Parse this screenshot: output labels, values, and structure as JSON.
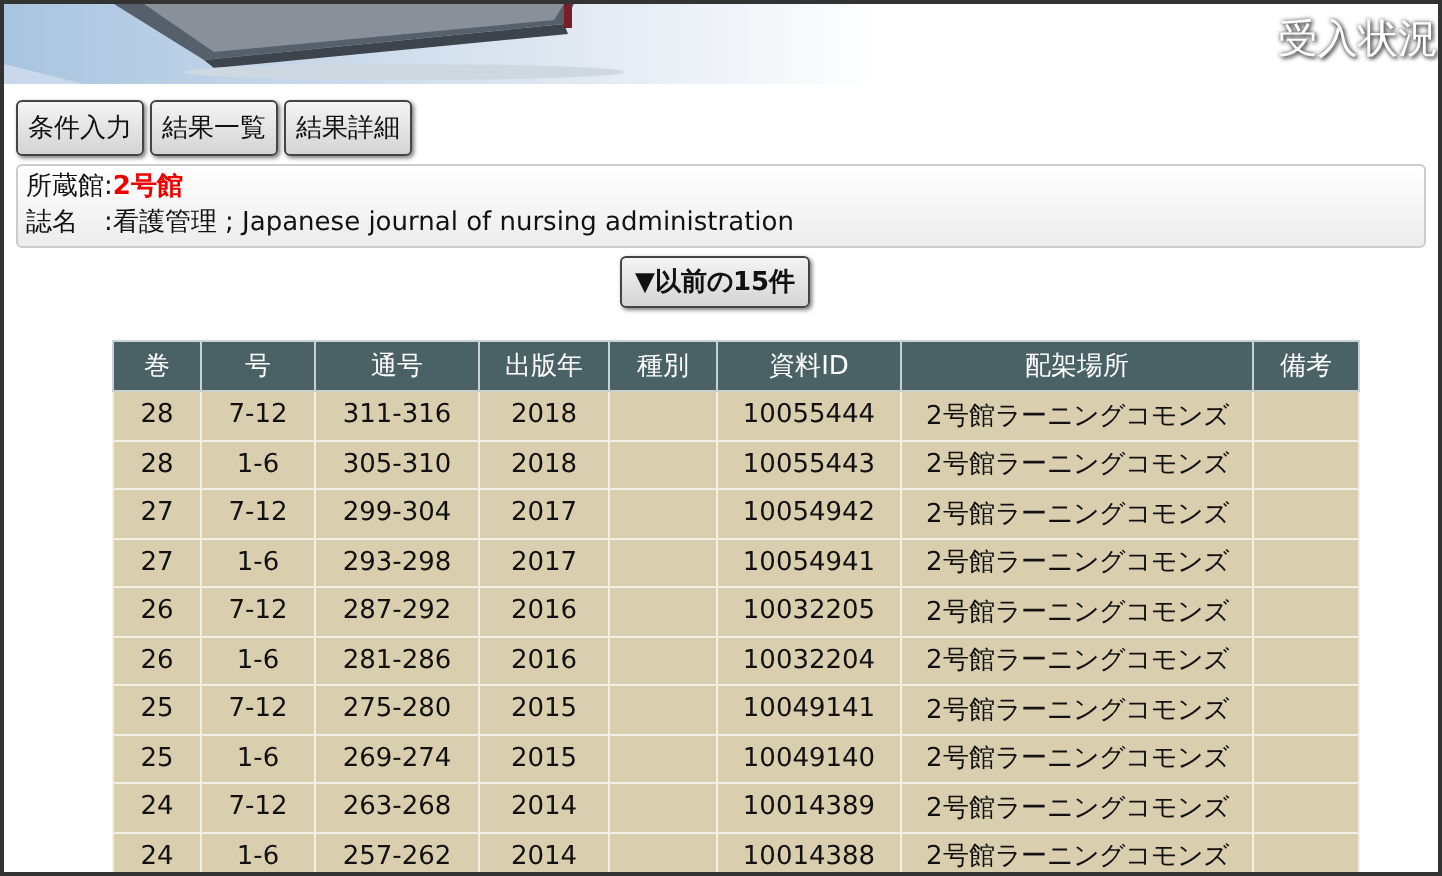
{
  "header": {
    "title": "受入状況"
  },
  "buttons": [
    {
      "label": "条件入力"
    },
    {
      "label": "結果一覧"
    },
    {
      "label": "結果詳細"
    }
  ],
  "info": {
    "library_label": "所蔵館:",
    "library": "2号館",
    "journal_label": "誌名　:",
    "journal": "看護管理 ; Japanese journal of nursing administration"
  },
  "previous_button": "▼以前の15件",
  "table": {
    "columns": [
      "巻",
      "号",
      "通号",
      "出版年",
      "種別",
      "資料ID",
      "配架場所",
      "備考"
    ],
    "rows": [
      [
        "28",
        "7-12",
        "311-316",
        "2018",
        "",
        "10055444",
        "2号館ラーニングコモンズ",
        ""
      ],
      [
        "28",
        "1-6",
        "305-310",
        "2018",
        "",
        "10055443",
        "2号館ラーニングコモンズ",
        ""
      ],
      [
        "27",
        "7-12",
        "299-304",
        "2017",
        "",
        "10054942",
        "2号館ラーニングコモンズ",
        ""
      ],
      [
        "27",
        "1-6",
        "293-298",
        "2017",
        "",
        "10054941",
        "2号館ラーニングコモンズ",
        ""
      ],
      [
        "26",
        "7-12",
        "287-292",
        "2016",
        "",
        "10032205",
        "2号館ラーニングコモンズ",
        ""
      ],
      [
        "26",
        "1-6",
        "281-286",
        "2016",
        "",
        "10032204",
        "2号館ラーニングコモンズ",
        ""
      ],
      [
        "25",
        "7-12",
        "275-280",
        "2015",
        "",
        "10049141",
        "2号館ラーニングコモンズ",
        ""
      ],
      [
        "25",
        "1-6",
        "269-274",
        "2015",
        "",
        "10049140",
        "2号館ラーニングコモンズ",
        ""
      ],
      [
        "24",
        "7-12",
        "263-268",
        "2014",
        "",
        "10014389",
        "2号館ラーニングコモンズ",
        ""
      ],
      [
        "24",
        "1-6",
        "257-262",
        "2014",
        "",
        "10014388",
        "2号館ラーニングコモンズ",
        ""
      ]
    ]
  }
}
